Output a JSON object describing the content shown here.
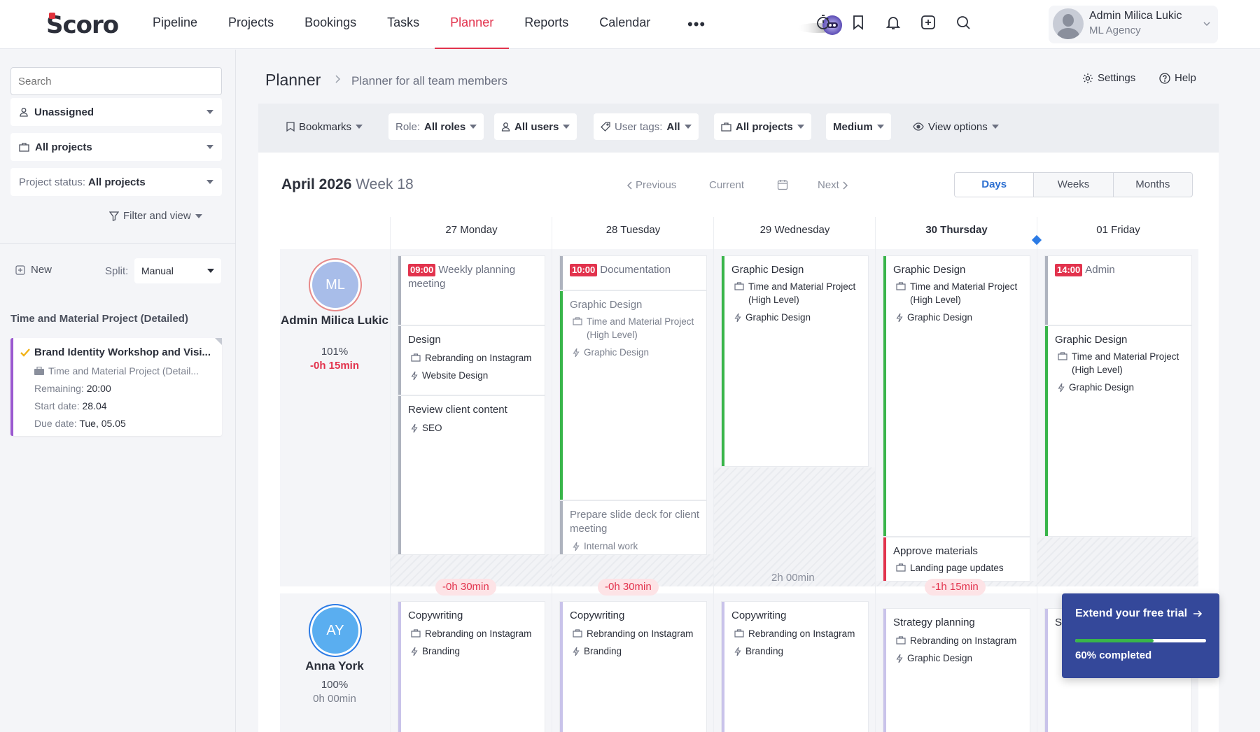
{
  "app": {
    "logo": "Scoro"
  },
  "nav": {
    "items": [
      "Pipeline",
      "Projects",
      "Bookings",
      "Tasks",
      "Planner",
      "Reports",
      "Calendar"
    ],
    "active": "Planner",
    "more": "•••",
    "icons": [
      "stopwatch-icon",
      "bookmark-icon",
      "bell-icon",
      "plus-square-icon",
      "search-icon"
    ]
  },
  "user": {
    "name": "Admin Milica Lukic",
    "org": "ML Agency"
  },
  "sidebar": {
    "search_placeholder": "Search",
    "unassigned": "Unassigned",
    "all_projects": "All projects",
    "project_status_label": "Project status:",
    "project_status_value": "All projects",
    "filter_and_view": "Filter and view",
    "new": "New",
    "split_label": "Split:",
    "split_value": "Manual",
    "section_title": "Time and Material Project (Detailed)",
    "task": {
      "title": "Brand Identity Workshop and Visi...",
      "project": "Time and Material Project (Detail...",
      "remaining_label": "Remaining:",
      "remaining": "20:00",
      "start_label": "Start date:",
      "start": "28.04",
      "due_label": "Due date:",
      "due": "Tue, 05.05",
      "accent": "#9b59d0"
    }
  },
  "page": {
    "title": "Planner",
    "subtitle": "Planner for all team members",
    "settings": "Settings",
    "help": "Help"
  },
  "filters": {
    "bookmarks": "Bookmarks",
    "role_label": "Role:",
    "role_value": "All roles",
    "users": "All users",
    "tags_label": "User tags:",
    "tags_value": "All",
    "projects": "All projects",
    "size": "Medium",
    "view_options": "View options"
  },
  "week": {
    "month": "April 2026",
    "week": "Week 18",
    "previous": "Previous",
    "current": "Current",
    "next": "Next",
    "modes": [
      "Days",
      "Weeks",
      "Months"
    ],
    "active_mode": "Days",
    "days": [
      "27 Monday",
      "28 Tuesday",
      "29 Wednesday",
      "30 Thursday",
      "01 Friday"
    ],
    "today_index": 3
  },
  "people": [
    {
      "initials": "ML",
      "name": "Admin Milica Lukic",
      "utilization": "101%",
      "balance": "-0h 15min",
      "avatar_color": "#a8bde9",
      "ring_color": "#e88a8a",
      "badges": [
        "-0h 30min",
        "-0h 30min",
        "",
        "-1h 15min",
        ""
      ],
      "free": [
        "",
        "",
        "2h 00min",
        "",
        ""
      ]
    },
    {
      "initials": "AY",
      "name": "Anna York",
      "utilization": "100%",
      "balance": "0h 00min",
      "avatar_color": "#5aaef0",
      "ring_color": "#2c7be5"
    }
  ],
  "events": {
    "ml": [
      {
        "day": 0,
        "time": "09:00",
        "title": "Weekly planning meeting",
        "color": "grey"
      },
      {
        "day": 0,
        "title": "Design",
        "project": "Rebranding on Instagram",
        "task": "Website Design",
        "color": "grey"
      },
      {
        "day": 0,
        "title": "Review client content",
        "task": "SEO",
        "color": "grey"
      },
      {
        "day": 1,
        "time": "10:00",
        "title": "Documentation",
        "color": "grey"
      },
      {
        "day": 1,
        "title": "Graphic Design",
        "project": "Time and Material Project (High Level)",
        "task": "Graphic Design",
        "color": "green"
      },
      {
        "day": 1,
        "title": "Prepare slide deck for client meeting",
        "task": "Internal work",
        "color": "grey"
      },
      {
        "day": 2,
        "title": "Graphic Design",
        "project": "Time and Material Project (High Level)",
        "task": "Graphic Design",
        "color": "green"
      },
      {
        "day": 3,
        "title": "Graphic Design",
        "project": "Time and Material Project (High Level)",
        "task": "Graphic Design",
        "color": "green"
      },
      {
        "day": 3,
        "title": "Approve materials",
        "project": "Landing page updates",
        "color": "red"
      },
      {
        "day": 4,
        "time": "14:00",
        "title": "Admin",
        "color": "grey"
      },
      {
        "day": 4,
        "title": "Graphic Design",
        "project": "Time and Material Project (High Level)",
        "task": "Graphic Design",
        "color": "green"
      }
    ],
    "ay": [
      {
        "day": 0,
        "title": "Copywriting",
        "project": "Rebranding on Instagram",
        "task": "Branding"
      },
      {
        "day": 1,
        "title": "Copywriting",
        "project": "Rebranding on Instagram",
        "task": "Branding"
      },
      {
        "day": 2,
        "title": "Copywriting",
        "project": "Rebranding on Instagram",
        "task": "Branding"
      },
      {
        "day": 3,
        "title": "Strategy planning",
        "project": "Rebranding on Instagram",
        "task": "Graphic Design"
      },
      {
        "day": 4,
        "title": "S"
      }
    ]
  },
  "trial": {
    "title": "Extend your free trial",
    "progress_label": "60% completed",
    "progress": 0.6
  },
  "colors": {
    "accent": "#e2334d",
    "brand_blue": "#2c6fd1",
    "green": "#39b54a",
    "trial_bg": "#34489a"
  }
}
